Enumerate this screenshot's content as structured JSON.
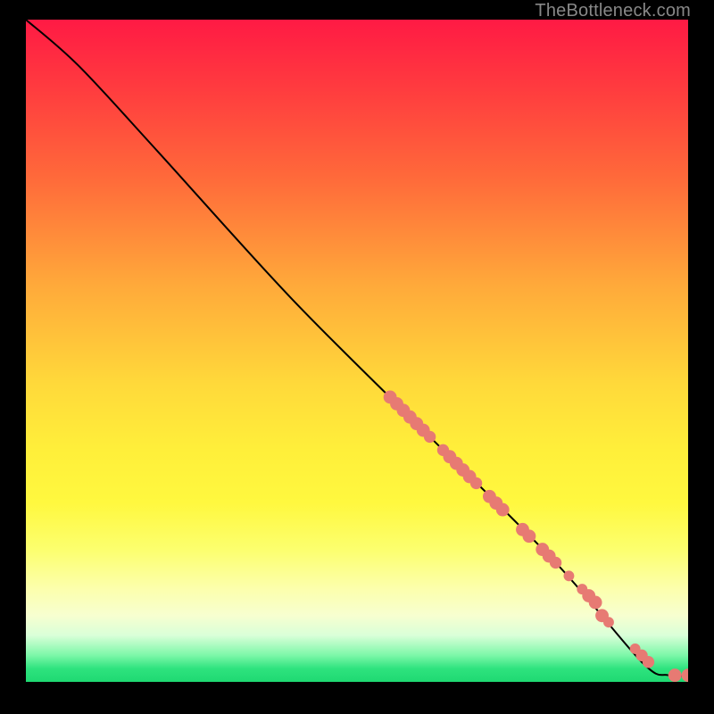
{
  "attribution": "TheBottleneck.com",
  "chart_data": {
    "type": "line",
    "title": "",
    "xlabel": "",
    "ylabel": "",
    "xlim": [
      0,
      100
    ],
    "ylim": [
      0,
      100
    ],
    "background_gradient": [
      {
        "pos": 0,
        "color": "#ff1a44"
      },
      {
        "pos": 50,
        "color": "#ffd93a"
      },
      {
        "pos": 80,
        "color": "#fcff6e"
      },
      {
        "pos": 96,
        "color": "#7cf7a8"
      },
      {
        "pos": 100,
        "color": "#1fd972"
      }
    ],
    "curve": [
      {
        "x": 0,
        "y": 100
      },
      {
        "x": 8,
        "y": 93
      },
      {
        "x": 20,
        "y": 80
      },
      {
        "x": 40,
        "y": 58
      },
      {
        "x": 60,
        "y": 38
      },
      {
        "x": 80,
        "y": 18
      },
      {
        "x": 93,
        "y": 3
      },
      {
        "x": 97,
        "y": 1
      },
      {
        "x": 100,
        "y": 1
      }
    ],
    "marker_clusters": [
      {
        "name": "upper-cluster",
        "points": [
          {
            "x": 55,
            "y": 43,
            "r": 1.0
          },
          {
            "x": 56,
            "y": 42,
            "r": 1.0
          },
          {
            "x": 57,
            "y": 41,
            "r": 1.0
          },
          {
            "x": 58,
            "y": 40,
            "r": 1.0
          },
          {
            "x": 59,
            "y": 39,
            "r": 1.0
          },
          {
            "x": 60,
            "y": 38,
            "r": 1.0
          },
          {
            "x": 61,
            "y": 37,
            "r": 0.9
          },
          {
            "x": 63,
            "y": 35,
            "r": 0.9
          },
          {
            "x": 64,
            "y": 34,
            "r": 1.0
          },
          {
            "x": 65,
            "y": 33,
            "r": 1.0
          },
          {
            "x": 66,
            "y": 32,
            "r": 1.0
          },
          {
            "x": 67,
            "y": 31,
            "r": 1.0
          },
          {
            "x": 68,
            "y": 30,
            "r": 0.9
          },
          {
            "x": 70,
            "y": 28,
            "r": 1.0
          },
          {
            "x": 71,
            "y": 27,
            "r": 1.0
          },
          {
            "x": 72,
            "y": 26,
            "r": 1.0
          },
          {
            "x": 75,
            "y": 23,
            "r": 1.0
          },
          {
            "x": 76,
            "y": 22,
            "r": 1.0
          },
          {
            "x": 78,
            "y": 20,
            "r": 1.0
          },
          {
            "x": 79,
            "y": 19,
            "r": 1.0
          },
          {
            "x": 80,
            "y": 18,
            "r": 0.9
          },
          {
            "x": 82,
            "y": 16,
            "r": 0.8
          },
          {
            "x": 84,
            "y": 14,
            "r": 0.8
          },
          {
            "x": 85,
            "y": 13,
            "r": 1.0
          },
          {
            "x": 86,
            "y": 12,
            "r": 1.0
          },
          {
            "x": 87,
            "y": 10,
            "r": 1.0
          },
          {
            "x": 88,
            "y": 9,
            "r": 0.8
          }
        ]
      },
      {
        "name": "tail-cluster",
        "points": [
          {
            "x": 92,
            "y": 5,
            "r": 0.8
          },
          {
            "x": 93,
            "y": 4,
            "r": 0.9
          },
          {
            "x": 94,
            "y": 3,
            "r": 0.9
          },
          {
            "x": 98,
            "y": 1,
            "r": 1.0
          },
          {
            "x": 100,
            "y": 1,
            "r": 1.0
          }
        ]
      }
    ]
  }
}
